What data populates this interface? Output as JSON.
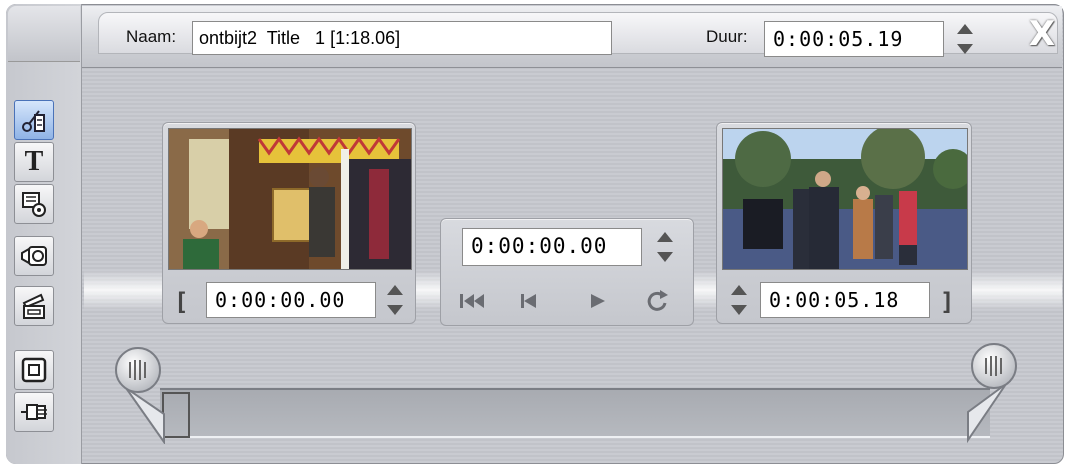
{
  "window": {
    "name_label": "Naam:",
    "name_value": "ontbijt2  Title   1 [1:18.06]",
    "duration_label": "Duur:",
    "duration_value": "0:00:05.19",
    "close_label": "X"
  },
  "toolbar": {
    "tools": [
      {
        "icon": "scissors-clip-icon",
        "active": true
      },
      {
        "icon": "title-text-icon",
        "text": "T"
      },
      {
        "icon": "audio-clip-icon"
      },
      {
        "icon": "camera-capture-icon"
      },
      {
        "icon": "clapperboard-icon"
      },
      {
        "icon": "frame-box-icon"
      },
      {
        "icon": "plug-icon"
      }
    ]
  },
  "start_panel": {
    "open_bracket": "[",
    "timecode": "0:00:00.00"
  },
  "center_panel": {
    "timecode": "0:00:00.00"
  },
  "end_panel": {
    "close_bracket": "]",
    "timecode": "0:00:05.18"
  },
  "colors": {
    "active_tool": "#8fb3e6",
    "frame": "#c5c7cd",
    "close_x": "#ffffff"
  }
}
